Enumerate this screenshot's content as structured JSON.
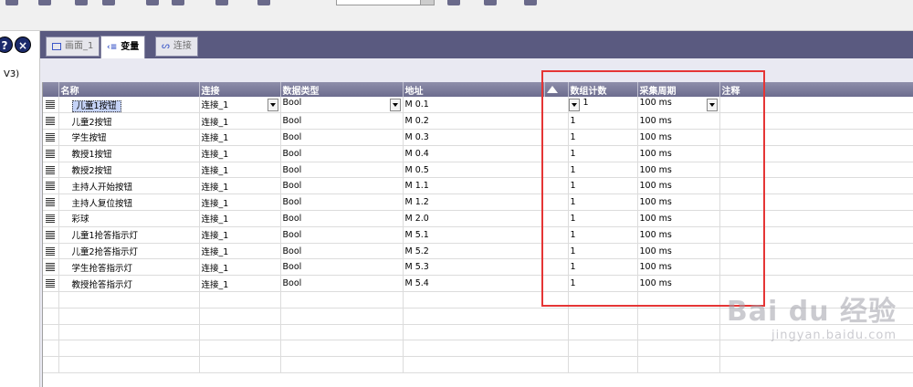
{
  "side_panel": {
    "label": "V3)",
    "help_label": "?",
    "close_label": "×"
  },
  "tabs": [
    {
      "label": "画面_1"
    },
    {
      "label": "变量"
    },
    {
      "label": "连接"
    }
  ],
  "table": {
    "headers": {
      "name": "名称",
      "connection": "连接",
      "datatype": "数据类型",
      "address": "地址",
      "array_count": "数组计数",
      "cycle": "采集周期",
      "comment": "注释"
    },
    "rows": [
      {
        "name": "儿童1按钮",
        "connection": "连接_1",
        "datatype": "Bool",
        "address": "M 0.1",
        "array_count": "1",
        "cycle": "100 ms",
        "comment": ""
      },
      {
        "name": "儿童2按钮",
        "connection": "连接_1",
        "datatype": "Bool",
        "address": "M 0.2",
        "array_count": "1",
        "cycle": "100 ms",
        "comment": ""
      },
      {
        "name": "学生按钮",
        "connection": "连接_1",
        "datatype": "Bool",
        "address": "M 0.3",
        "array_count": "1",
        "cycle": "100 ms",
        "comment": ""
      },
      {
        "name": "教授1按钮",
        "connection": "连接_1",
        "datatype": "Bool",
        "address": "M 0.4",
        "array_count": "1",
        "cycle": "100 ms",
        "comment": ""
      },
      {
        "name": "教授2按钮",
        "connection": "连接_1",
        "datatype": "Bool",
        "address": "M 0.5",
        "array_count": "1",
        "cycle": "100 ms",
        "comment": ""
      },
      {
        "name": "主持人开始按钮",
        "connection": "连接_1",
        "datatype": "Bool",
        "address": "M 1.1",
        "array_count": "1",
        "cycle": "100 ms",
        "comment": ""
      },
      {
        "name": "主持人复位按钮",
        "connection": "连接_1",
        "datatype": "Bool",
        "address": "M 1.2",
        "array_count": "1",
        "cycle": "100 ms",
        "comment": ""
      },
      {
        "name": "彩球",
        "connection": "连接_1",
        "datatype": "Bool",
        "address": "M 2.0",
        "array_count": "1",
        "cycle": "100 ms",
        "comment": ""
      },
      {
        "name": "儿童1抢答指示灯",
        "connection": "连接_1",
        "datatype": "Bool",
        "address": "M 5.1",
        "array_count": "1",
        "cycle": "100 ms",
        "comment": ""
      },
      {
        "name": "儿童2抢答指示灯",
        "connection": "连接_1",
        "datatype": "Bool",
        "address": "M 5.2",
        "array_count": "1",
        "cycle": "100 ms",
        "comment": ""
      },
      {
        "name": "学生抢答指示灯",
        "connection": "连接_1",
        "datatype": "Bool",
        "address": "M 5.3",
        "array_count": "1",
        "cycle": "100 ms",
        "comment": ""
      },
      {
        "name": "教授抢答指示灯",
        "connection": "连接_1",
        "datatype": "Bool",
        "address": "M 5.4",
        "array_count": "1",
        "cycle": "100 ms",
        "comment": ""
      }
    ]
  },
  "watermark": {
    "main": "Bai du 经验",
    "sub": "jingyan.baidu.com"
  },
  "colors": {
    "header_bg": "#7a7a9a",
    "tab_bar_bg": "#5a5a80",
    "highlight": "#e53535",
    "selection": "#c5d3f7"
  }
}
